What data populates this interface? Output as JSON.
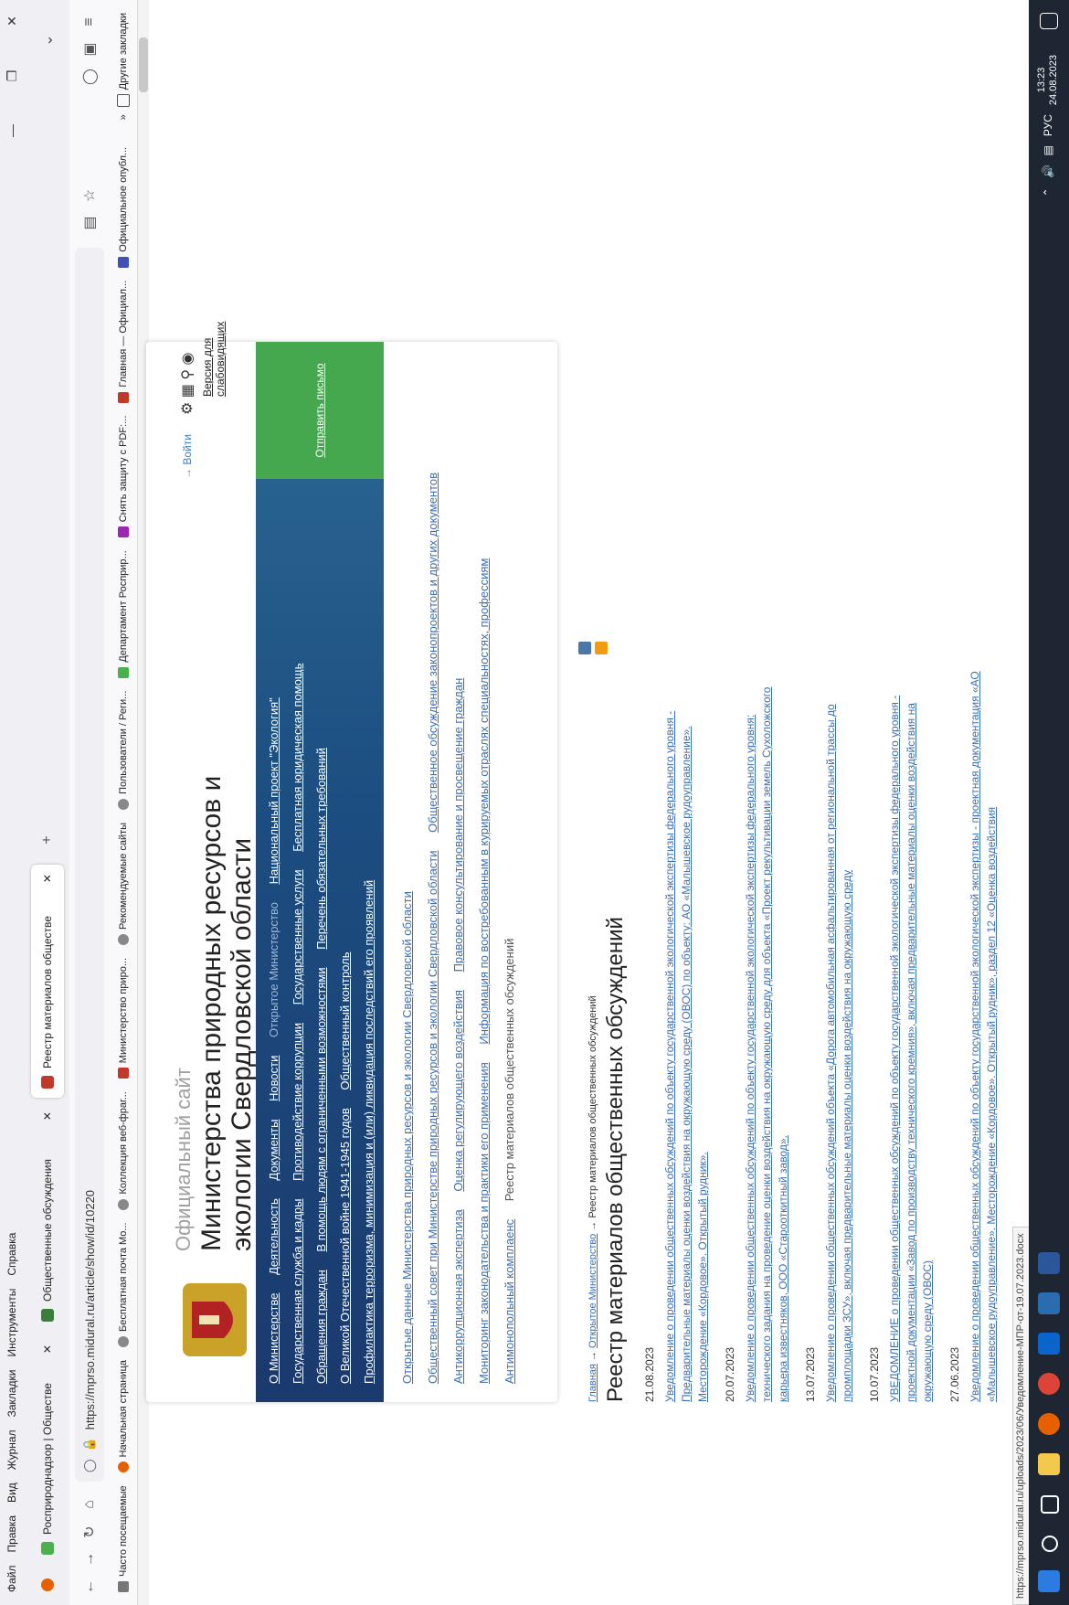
{
  "menubar": {
    "items": [
      "Файл",
      "Правка",
      "Вид",
      "Журнал",
      "Закладки",
      "Инструменты",
      "Справка"
    ]
  },
  "tabs": [
    {
      "label": "Росприроднадзор | Обществе"
    },
    {
      "label": "Общественные обсуждения"
    },
    {
      "label": "Реестр материалов обществе"
    }
  ],
  "url": "https://mprso.midural.ru/article/show/id/10220",
  "bookmarks": [
    "Часто посещаемые",
    "Начальная страница",
    "Бесплатная почта Mo...",
    "Коллекция веб-фраг...",
    "Министерство приро...",
    "Рекомендуемые сайты",
    "Пользователи / Реги...",
    "Департамент Росприр...",
    "Снять защиту с PDF:...",
    "Главная — Официал...",
    "Официальное опубл...",
    "Другие закладки"
  ],
  "site": {
    "pre_title": "Официальный сайт",
    "title_line1": "Министерства природных ресурсов и",
    "title_line2": "экологии Свердловской области",
    "login": "Войти",
    "vision_line1": "Версия для",
    "vision_line2": "слабовидящих",
    "send_letter": "Отправить письмо"
  },
  "nav": {
    "row1": [
      "О Министерстве",
      "Деятельность",
      "Документы",
      "Новости",
      "Открытое Министерство",
      "Национальный проект \"Экология\""
    ],
    "row2": [
      "Государственная служба и кадры",
      "Противодействие коррупции",
      "Государственные услуги",
      "Бесплатная юридическая помощь"
    ],
    "row3": [
      "Обращения граждан",
      "В помощь людям с ограниченными возможностями",
      "Перечень обязательных требований"
    ],
    "row4": [
      "О Великой Отечественной войне 1941-1945 годов",
      "Общественный контроль"
    ],
    "row5": [
      "Профилактика терроризма, минимизация и (или) ликвидация последствий его проявлений"
    ]
  },
  "links": {
    "row1": [
      "Открытые данные Министерства природных ресурсов и экологии Свердловской области"
    ],
    "row2": [
      "Общественный совет при Министерстве природных ресурсов и экологии Свердловской области",
      "Общественное обсуждение законопроектов и других документов"
    ],
    "row3": [
      "Антикоррупционная экспертиза",
      "Оценка регулирующего воздействия",
      "Правовое консультирование и просвещение граждан"
    ],
    "row4": [
      "Мониторинг законодательства и практики его применения",
      "Информация по востребованным в курируемых отраслях специальностях, профессиям"
    ],
    "row5": [
      "Антимонопольный комплаенс",
      "Реестр материалов общественных обсуждений"
    ]
  },
  "breadcrumb": {
    "home": "Главная",
    "section": "Открытое Министерство",
    "current": "Реестр материалов общественных обсуждений"
  },
  "page_title": "Реестр материалов общественных обсуждений",
  "documents": [
    {
      "date": "21.08.2023",
      "text": "Уведомление о проведении общественных обсуждений по объекту государственной экологической экспертизы федерального уровня - Предварительные материалы оценки воздействия на окружающую среду (ОВОС) по объекту: АО «Малышевское рудоуправление». Месторождение «Кордовое». Открытый рудник»."
    },
    {
      "date": "20.07.2023",
      "text": "Уведомление о проведении общественных обсуждений по объекту государственной экологической экспертизы федерального уровня: технического задания на проведение оценки воздействия на окружающую среду для объекта «Проект рекультивации земель Сухоложского карьера известняков, ООО «Старооткитный завод»."
    },
    {
      "date": "13.07.2023",
      "text": "Уведомление о проведении общественных обсуждений объекта «Дорога автомобильная асфальтированная от региональной трассы до промплощадки ЗСУ», включая предварительные материалы оценки воздействия на окружающую среду"
    },
    {
      "date": "10.07.2023",
      "text": "УВЕДОМЛЕНИЕ о проведении общественных обсуждений по объекту государственной экологической экспертизы федерального уровня - проектной документации «Завод по производству технического кремния», включая предварительные материалы оценки воздействия на окружающую среду (ОВОС)"
    },
    {
      "date": "27.06.2023",
      "text": "Уведомление о проведении общественных обсуждений по объекту государственной экологической экспертизы - проектная документация «АО «Малышевское рудоуправление». Месторождение «Кордовое». Открытый рудник», раздел 12 «Оценка воздействия"
    }
  ],
  "status_url": "https://mprso.midural.ru/uploads/2023/06/Уведомление-МПР-от-19.07.2023.docx",
  "tray": {
    "lang": "РУС",
    "time": "13:23",
    "date": "24.08.2023"
  }
}
